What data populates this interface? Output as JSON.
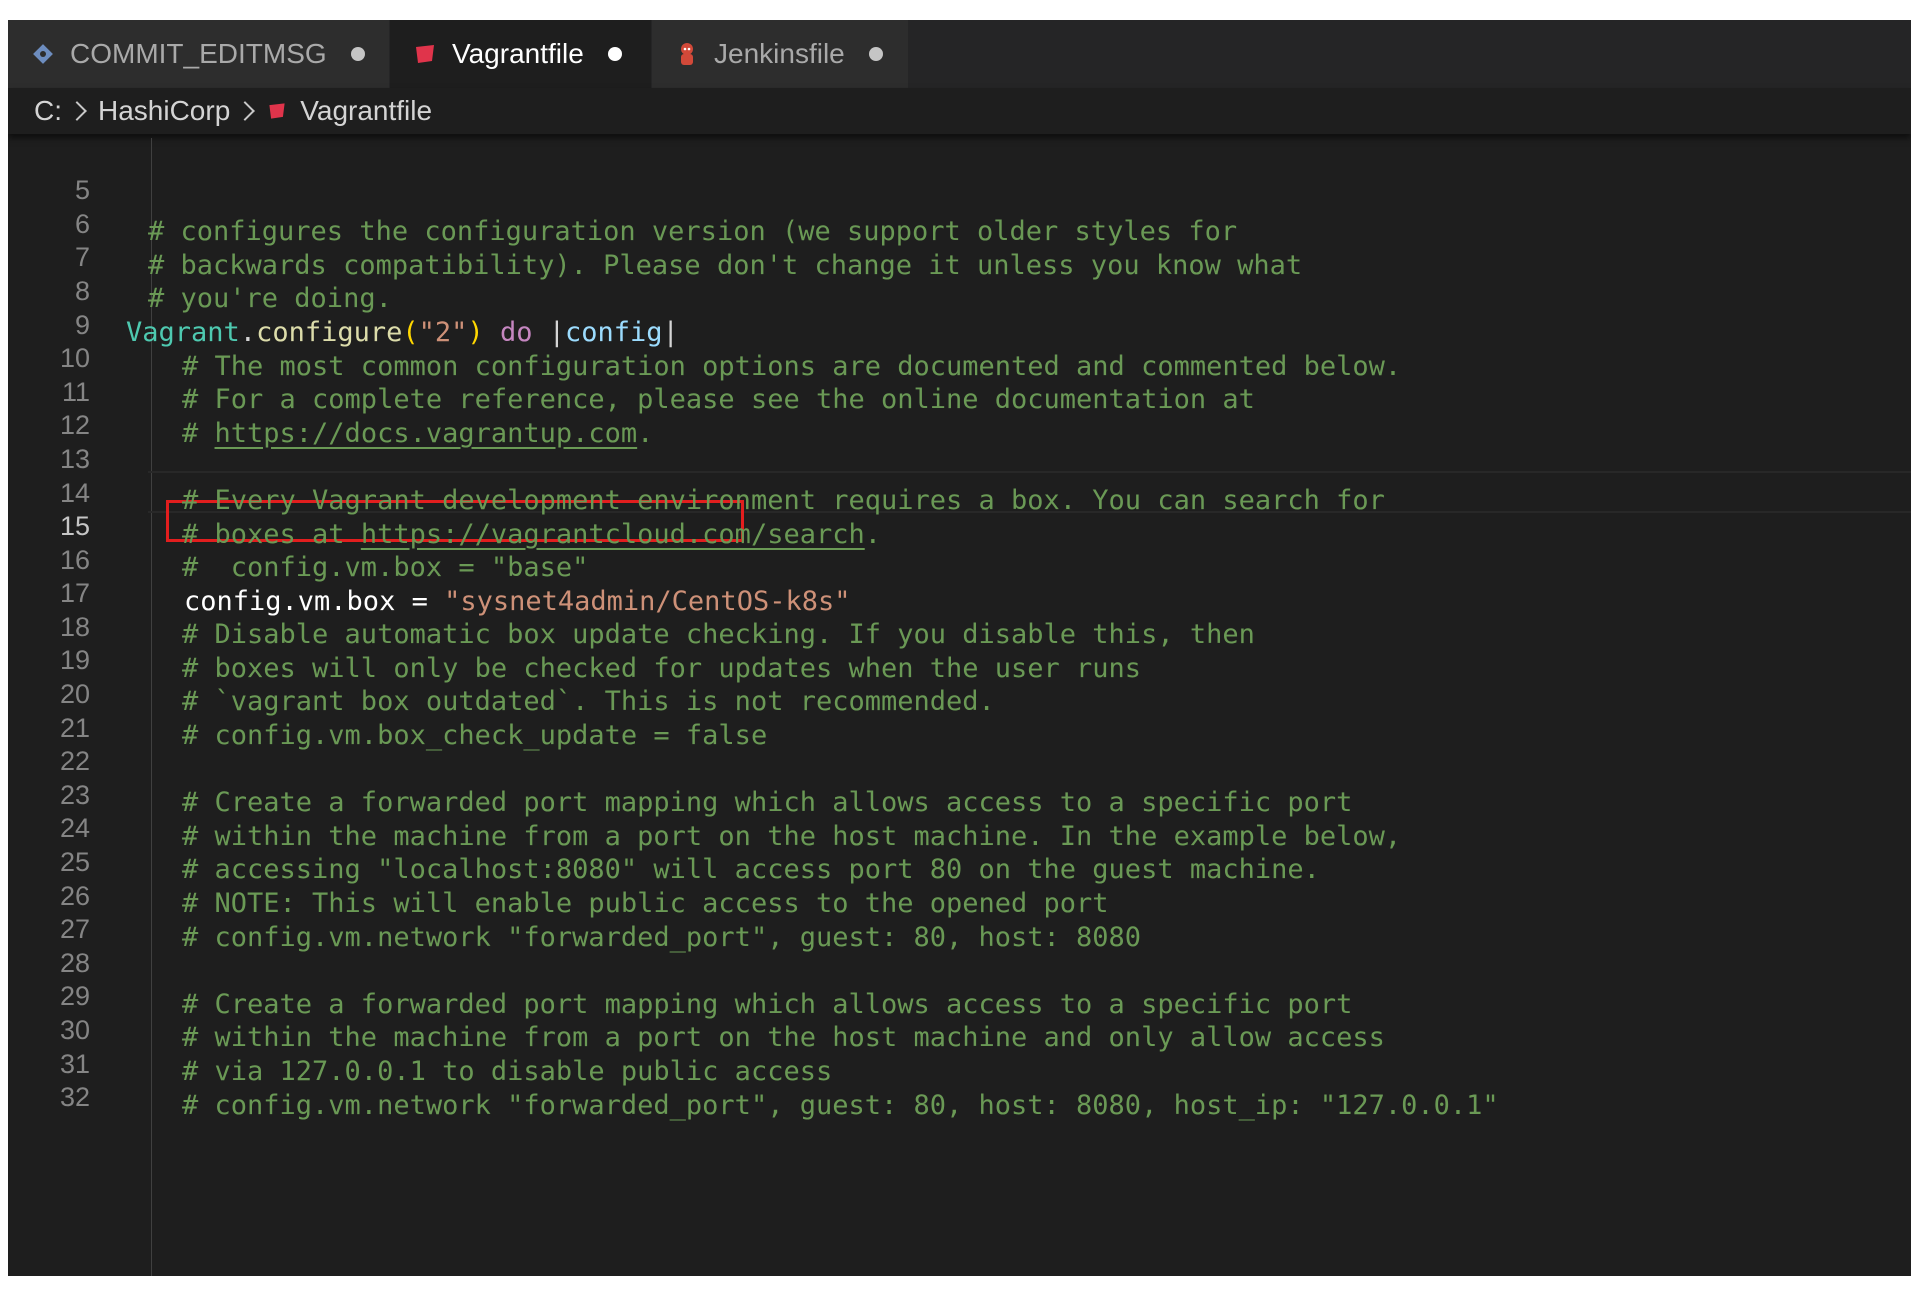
{
  "tabs": [
    {
      "label": "COMMIT_EDITMSG",
      "icon": "git-diamond-icon",
      "modified": true,
      "active": false,
      "color": "#6d8dbf"
    },
    {
      "label": "Vagrantfile",
      "icon": "vagrant-icon",
      "modified": true,
      "active": true,
      "color": "#e0344b"
    },
    {
      "label": "Jenkinsfile",
      "icon": "jenkins-icon",
      "modified": true,
      "active": false,
      "color": "#d24939"
    }
  ],
  "breadcrumb": {
    "items": [
      "C:",
      "HashiCorp",
      "Vagrantfile"
    ],
    "file_icon": "vagrant-icon"
  },
  "editor": {
    "current_line": 15,
    "highlighted_line": 16,
    "highlight_color": "#e21e1e",
    "lines": [
      {
        "num": "5",
        "text": "# configures the configuration version (we support older styles for"
      },
      {
        "num": "6",
        "text": "# backwards compatibility). Please don't change it unless you know what"
      },
      {
        "num": "7",
        "text": "# you're doing."
      },
      {
        "num": "8",
        "tokens": {
          "cls": "Vagrant",
          "dot": ".",
          "fn": "configure",
          "open": "(",
          "str": "\"2\"",
          "close": ")",
          "space": " ",
          "ctl": "do",
          "pipe1": " |",
          "var": "config",
          "pipe2": "|"
        }
      },
      {
        "num": "9",
        "text": "# The most common configuration options are documented and commented below."
      },
      {
        "num": "10",
        "text": "# For a complete reference, please see the online documentation at"
      },
      {
        "num": "11",
        "prefix": "# ",
        "url": "https://docs.vagrantup.com",
        "suffix": "."
      },
      {
        "num": "12",
        "text": ""
      },
      {
        "num": "13",
        "text": "# Every Vagrant development environment requires a box. You can search for"
      },
      {
        "num": "14",
        "prefix": "# boxes at ",
        "url": "https://vagrantcloud.com/search",
        "suffix": "."
      },
      {
        "num": "15",
        "text": "#  config.vm.box = \"base\""
      },
      {
        "num": "16",
        "tokens": {
          "lhs": "config.vm.box = ",
          "str": "\"sysnet4admin/CentOS-k8s\""
        }
      },
      {
        "num": "17",
        "text": "# Disable automatic box update checking. If you disable this, then"
      },
      {
        "num": "18",
        "text": "# boxes will only be checked for updates when the user runs"
      },
      {
        "num": "19",
        "text": "# `vagrant box outdated`. This is not recommended."
      },
      {
        "num": "20",
        "text": "# config.vm.box_check_update = false"
      },
      {
        "num": "21",
        "text": ""
      },
      {
        "num": "22",
        "text": "# Create a forwarded port mapping which allows access to a specific port"
      },
      {
        "num": "23",
        "text": "# within the machine from a port on the host machine. In the example below,"
      },
      {
        "num": "24",
        "text": "# accessing \"localhost:8080\" will access port 80 on the guest machine."
      },
      {
        "num": "25",
        "text": "# NOTE: This will enable public access to the opened port"
      },
      {
        "num": "26",
        "text": "# config.vm.network \"forwarded_port\", guest: 80, host: 8080"
      },
      {
        "num": "27",
        "text": ""
      },
      {
        "num": "28",
        "text": "# Create a forwarded port mapping which allows access to a specific port"
      },
      {
        "num": "29",
        "text": "# within the machine from a port on the host machine and only allow access"
      },
      {
        "num": "30",
        "text": "# via 127.0.0.1 to disable public access"
      },
      {
        "num": "31",
        "text": "# config.vm.network \"forwarded_port\", guest: 80, host: 8080, host_ip: \"127.0.0.1\""
      },
      {
        "num": "32",
        "text": ""
      }
    ]
  }
}
